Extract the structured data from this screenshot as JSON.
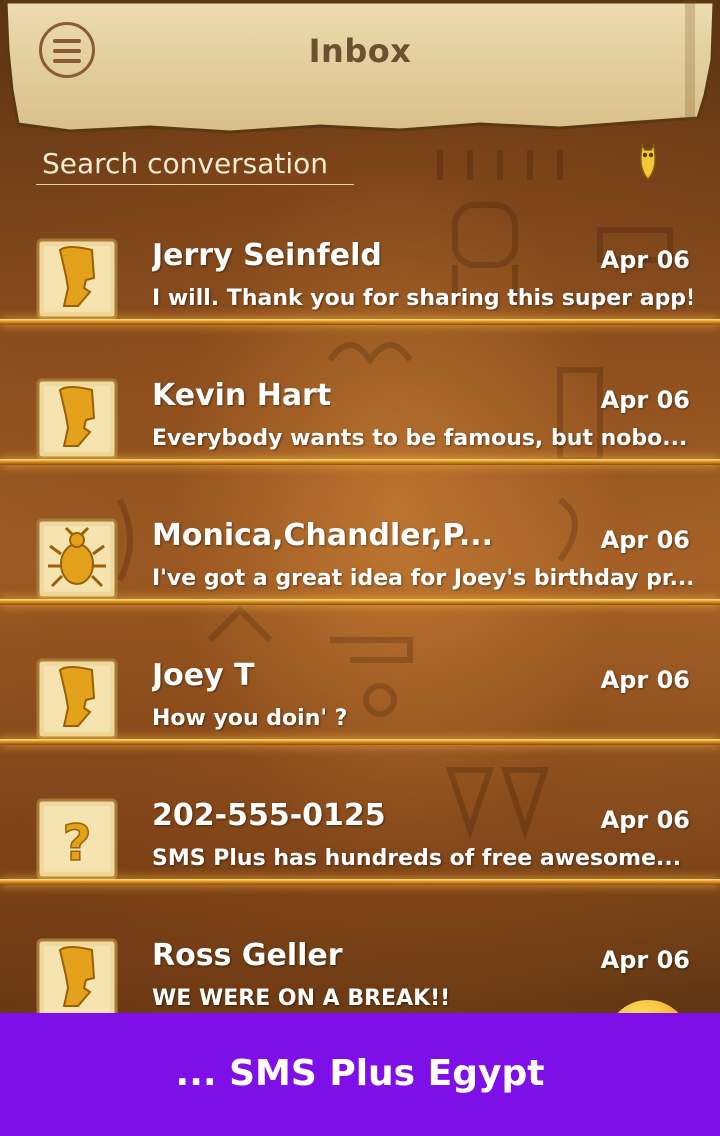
{
  "header": {
    "title": "Inbox",
    "menu_icon": "hamburger-menu-icon"
  },
  "search": {
    "placeholder": "Search conversation",
    "side_icon": "owl-icon"
  },
  "conversations": [
    {
      "name": "Jerry Seinfeld",
      "date": "Apr 06",
      "preview": "I will. Thank you for sharing this super app!",
      "avatar_icon": "nefertiti-icon"
    },
    {
      "name": "Kevin Hart",
      "date": "Apr 06",
      "preview": "Everybody wants to be famous, but nobo...",
      "avatar_icon": "nefertiti-icon"
    },
    {
      "name": "Monica,Chandler,P...",
      "date": "Apr 06",
      "preview": "I've got a great idea for Joey's birthday pr...",
      "avatar_icon": "scarab-icon"
    },
    {
      "name": "Joey T",
      "date": "Apr 06",
      "preview": "How you doin' ?",
      "avatar_icon": "nefertiti-icon"
    },
    {
      "name": "202-555-0125",
      "date": "Apr 06",
      "preview": "SMS Plus has hundreds of free awesome...",
      "avatar_icon": "question-mark-icon"
    },
    {
      "name": "Ross Geller",
      "date": "Apr 06",
      "preview": "WE WERE ON  A BREAK!!",
      "avatar_icon": "nefertiti-icon"
    }
  ],
  "banner": {
    "text": "... SMS Plus Egypt"
  },
  "colors": {
    "banner": "#7f0fe8",
    "divider_gold": "#e0931e",
    "title_brown": "#6a5130"
  }
}
